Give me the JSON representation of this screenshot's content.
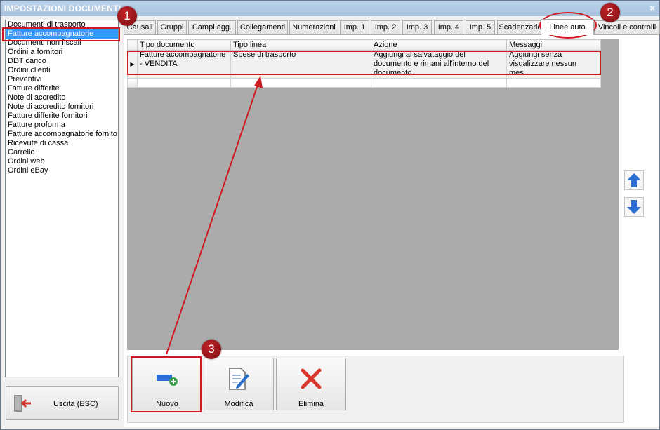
{
  "window": {
    "title": "IMPOSTAZIONI DOCUMENTI",
    "close_glyph": "×"
  },
  "doc_list": {
    "items": [
      "Documenti di trasporto",
      "Fatture accompagnatorie",
      "Documenti non fiscali",
      "Ordini a fornitori",
      "DDT carico",
      "Ordini clienti",
      "Preventivi",
      "Fatture differite",
      "Note di accredito",
      "Note di accredito fornitori",
      "Fatture differite fornitori",
      "Fatture proforma",
      "Fatture accompagnatorie fornito",
      "Ricevute di cassa",
      "Carrello",
      "Ordini web",
      "Ordini eBay"
    ],
    "selected_index": 1
  },
  "exit_button": {
    "label": "Uscita (ESC)",
    "icon": "exit-door-icon"
  },
  "tabs": [
    "Causali",
    "Gruppi",
    "Campi agg.",
    "Collegamenti",
    "Numerazioni",
    "Imp. 1",
    "Imp. 2",
    "Imp. 3",
    "Imp. 4",
    "Imp. 5",
    "Scadenzario",
    "Linee auto",
    "Vincoli e controlli"
  ],
  "active_tab": "Linee auto",
  "grid": {
    "columns": [
      "Tipo documento",
      "Tipo linea",
      "Azione",
      "Messaggi"
    ],
    "rows": [
      {
        "tipo_documento": "Fatture accompagnatorie - VENDITA",
        "tipo_linea": "Spese di trasporto",
        "azione": "Aggiungi al salvataggio del documento e rimani all'interno del documento",
        "messaggi": "Aggiungi senza visualizzare nessun mes..."
      }
    ]
  },
  "side_arrows": {
    "up_icon": "arrow-up-icon",
    "down_icon": "arrow-down-icon",
    "color": "#2a6fcf"
  },
  "buttons": [
    {
      "label": "Nuovo",
      "icon": "new-line-icon"
    },
    {
      "label": "Modifica",
      "icon": "edit-document-icon"
    },
    {
      "label": "Elimina",
      "icon": "delete-x-icon"
    }
  ],
  "annotations": {
    "badges": [
      "1",
      "2",
      "3"
    ],
    "color": "#d01820"
  }
}
